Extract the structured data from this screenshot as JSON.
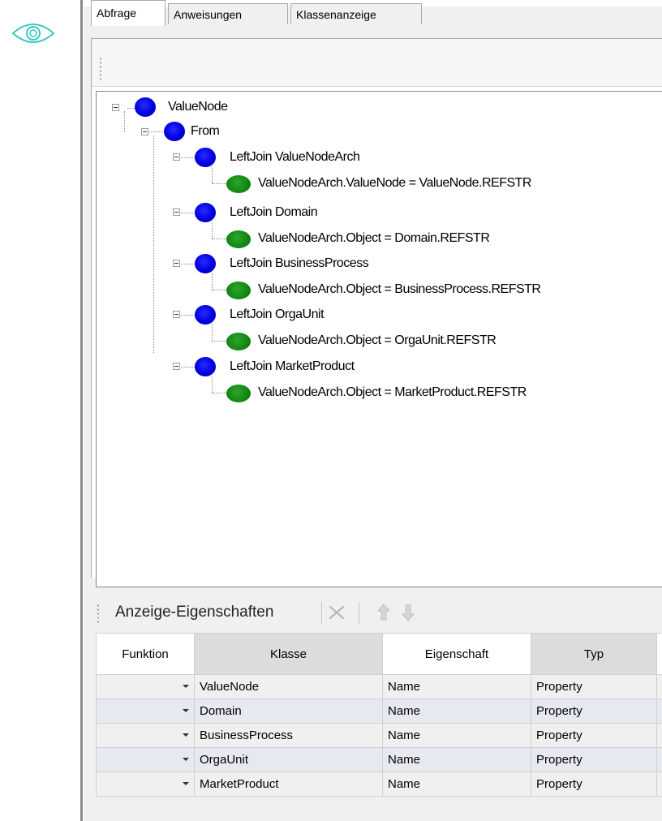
{
  "tabs": [
    {
      "label": "Abfrage",
      "active": true
    },
    {
      "label": "Anweisungen",
      "active": false
    },
    {
      "label": "Klassenanzeige",
      "active": false
    }
  ],
  "tree": {
    "root": "ValueNode",
    "from": "From",
    "joins": [
      {
        "label": "LeftJoin  ValueNodeArch",
        "condition": "ValueNodeArch.ValueNode = ValueNode.REFSTR"
      },
      {
        "label": "LeftJoin  Domain",
        "condition": "ValueNodeArch.Object = Domain.REFSTR"
      },
      {
        "label": "LeftJoin  BusinessProcess",
        "condition": "ValueNodeArch.Object = BusinessProcess.REFSTR"
      },
      {
        "label": "LeftJoin  OrgaUnit",
        "condition": "ValueNodeArch.Object = OrgaUnit.REFSTR"
      },
      {
        "label": "LeftJoin  MarketProduct",
        "condition": "ValueNodeArch.Object = MarketProduct.REFSTR"
      }
    ]
  },
  "properties": {
    "title": "Anzeige-Eigenschaften",
    "columns": [
      "Funktion",
      "Klasse",
      "Eigenschaft",
      "Typ"
    ],
    "rows": [
      {
        "funktion": "",
        "klasse": "ValueNode",
        "eigenschaft": "Name",
        "typ": "Property"
      },
      {
        "funktion": "",
        "klasse": "Domain",
        "eigenschaft": "Name",
        "typ": "Property"
      },
      {
        "funktion": "",
        "klasse": "BusinessProcess",
        "eigenschaft": "Name",
        "typ": "Property"
      },
      {
        "funktion": "",
        "klasse": "OrgaUnit",
        "eigenschaft": "Name",
        "typ": "Property"
      },
      {
        "funktion": "",
        "klasse": "MarketProduct",
        "eigenschaft": "Name",
        "typ": "Property"
      }
    ]
  },
  "colors": {
    "node_blue": "#0000e0",
    "node_green": "#138a13",
    "eye_teal": "#3cc8c0",
    "row_alt": "#e6e9ef"
  },
  "icons": [
    "eye-icon",
    "delete-icon",
    "move-up-icon",
    "move-down-icon",
    "dropdown-arrow-icon"
  ]
}
